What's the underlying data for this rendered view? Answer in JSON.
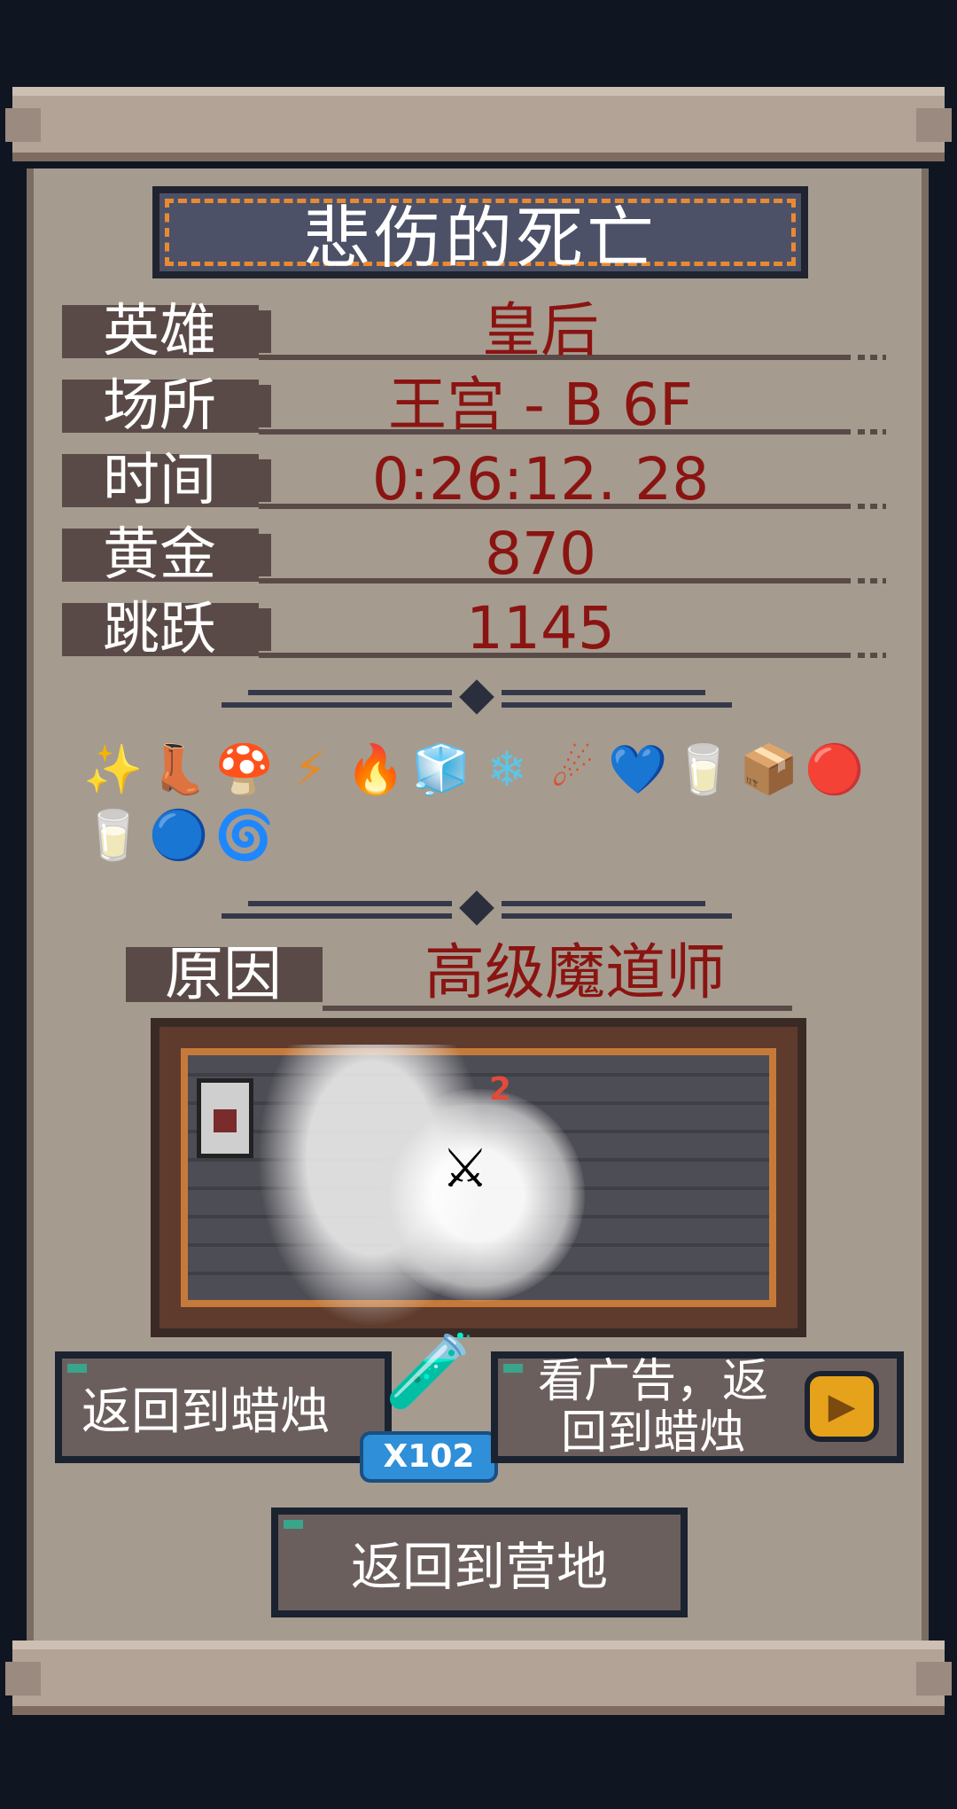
{
  "title": "悲伤的死亡",
  "stats": [
    {
      "label": "英雄",
      "value": "皇后"
    },
    {
      "label": "场所",
      "value": "王宫 - B 6F"
    },
    {
      "label": "时间",
      "value": "0:26:12. 28"
    },
    {
      "label": "黄金",
      "value": "870"
    },
    {
      "label": "跳跃",
      "value": "1145"
    }
  ],
  "items": [
    {
      "icon": "star-cluster-icon",
      "glyph": "✨",
      "color": "#c07ad6"
    },
    {
      "icon": "boot-icon",
      "glyph": "👢",
      "color": "#333333"
    },
    {
      "icon": "mushroom-cloud-icon",
      "glyph": "🍄",
      "color": "#d8502d"
    },
    {
      "icon": "lightning-icon",
      "glyph": "⚡",
      "color": "#e58a24"
    },
    {
      "icon": "fire-icon",
      "glyph": "🔥",
      "color": "#e0442a"
    },
    {
      "icon": "ice-cube-icon",
      "glyph": "🧊",
      "color": "#5ac6e8"
    },
    {
      "icon": "crossed-ice-icon",
      "glyph": "❄",
      "color": "#5ac6e8"
    },
    {
      "icon": "meteor-icon",
      "glyph": "☄",
      "color": "#d8502d"
    },
    {
      "icon": "blue-heart-icon",
      "glyph": "💙",
      "color": "#4aa8e8"
    },
    {
      "icon": "milk-bottle-icon",
      "glyph": "🥛",
      "color": "#e8e8e8"
    },
    {
      "icon": "red-crate-icon",
      "glyph": "📦",
      "color": "#b02828"
    },
    {
      "icon": "red-orb-icon",
      "glyph": "🔴",
      "color": "#c02a2a"
    },
    {
      "icon": "milk-bottle-icon",
      "glyph": "🥛",
      "color": "#e8e8e8"
    },
    {
      "icon": "fire-orb-icon",
      "glyph": "🔵",
      "color": "#e8702a"
    },
    {
      "icon": "green-swirl-icon",
      "glyph": "🌀",
      "color": "#4cb838"
    }
  ],
  "reason": {
    "label": "原因",
    "value": "高级魔道师"
  },
  "scene": {
    "damage_number": "2"
  },
  "buttons": {
    "return_candle": "返回到蜡烛",
    "potion_count": "X102",
    "watch_ad_line1": "看广告，返",
    "watch_ad_line2": "回到蜡烛",
    "return_camp": "返回到营地"
  }
}
